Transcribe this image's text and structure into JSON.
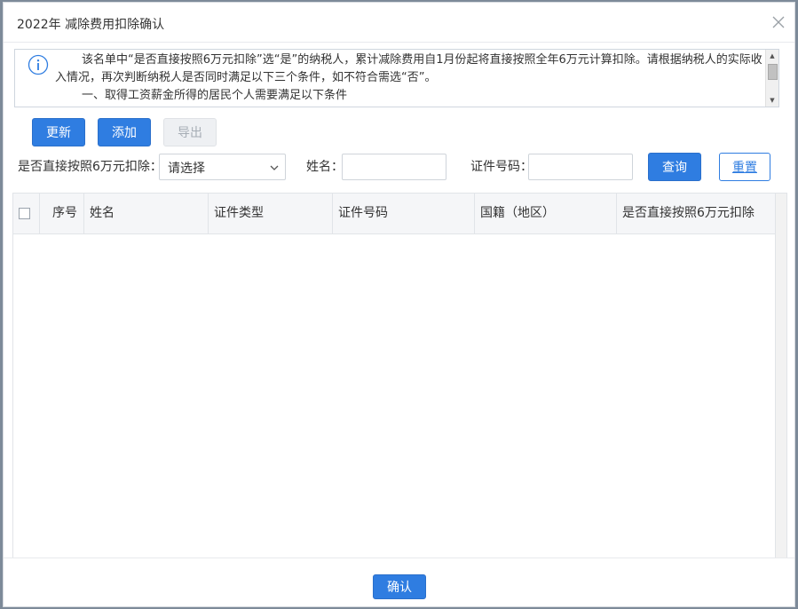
{
  "dialog": {
    "title": "2022年 减除费用扣除确认"
  },
  "notice": {
    "lines": [
      "该名单中“是否直接按照6万元扣除”选“是”的纳税人，累计减除费用自1月份起将直接按照全年6万元计算扣除。请根据纳税人的实际收入情况，再次判断纳税人是否同时满足以下三个条件，如不符合需选“否”。",
      "一、取得工资薪金所得的居民个人需要满足以下条件"
    ]
  },
  "toolbar": {
    "update": "更新",
    "add": "添加",
    "export": "导出"
  },
  "filters": {
    "deduct_label": "是否直接按照6万元扣除：",
    "deduct_value": "请选择",
    "name_label": "姓名：",
    "name_value": "",
    "id_label": "证件号码：",
    "id_value": "",
    "query": "查询",
    "reset": "重置"
  },
  "table": {
    "columns": [
      "序号",
      "姓名",
      "证件类型",
      "证件号码",
      "国籍（地区）",
      "是否直接按照6万元扣除"
    ],
    "rows": []
  },
  "footer": {
    "confirm": "确认"
  },
  "colors": {
    "primary": "#2f7de1",
    "header_bg": "#f5f6f8"
  }
}
